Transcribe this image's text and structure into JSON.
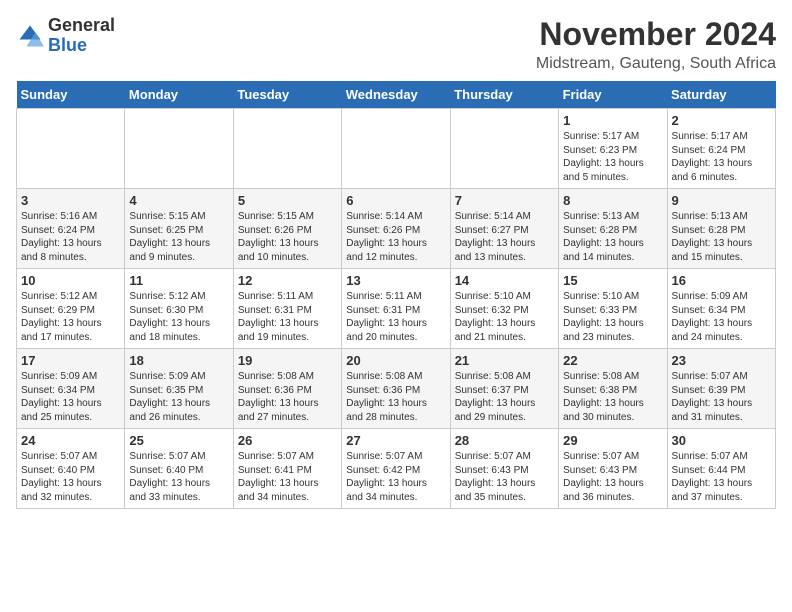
{
  "logo": {
    "general": "General",
    "blue": "Blue"
  },
  "title": "November 2024",
  "location": "Midstream, Gauteng, South Africa",
  "weekdays": [
    "Sunday",
    "Monday",
    "Tuesday",
    "Wednesday",
    "Thursday",
    "Friday",
    "Saturday"
  ],
  "weeks": [
    [
      {
        "day": "",
        "info": ""
      },
      {
        "day": "",
        "info": ""
      },
      {
        "day": "",
        "info": ""
      },
      {
        "day": "",
        "info": ""
      },
      {
        "day": "",
        "info": ""
      },
      {
        "day": "1",
        "info": "Sunrise: 5:17 AM\nSunset: 6:23 PM\nDaylight: 13 hours\nand 5 minutes."
      },
      {
        "day": "2",
        "info": "Sunrise: 5:17 AM\nSunset: 6:24 PM\nDaylight: 13 hours\nand 6 minutes."
      }
    ],
    [
      {
        "day": "3",
        "info": "Sunrise: 5:16 AM\nSunset: 6:24 PM\nDaylight: 13 hours\nand 8 minutes."
      },
      {
        "day": "4",
        "info": "Sunrise: 5:15 AM\nSunset: 6:25 PM\nDaylight: 13 hours\nand 9 minutes."
      },
      {
        "day": "5",
        "info": "Sunrise: 5:15 AM\nSunset: 6:26 PM\nDaylight: 13 hours\nand 10 minutes."
      },
      {
        "day": "6",
        "info": "Sunrise: 5:14 AM\nSunset: 6:26 PM\nDaylight: 13 hours\nand 12 minutes."
      },
      {
        "day": "7",
        "info": "Sunrise: 5:14 AM\nSunset: 6:27 PM\nDaylight: 13 hours\nand 13 minutes."
      },
      {
        "day": "8",
        "info": "Sunrise: 5:13 AM\nSunset: 6:28 PM\nDaylight: 13 hours\nand 14 minutes."
      },
      {
        "day": "9",
        "info": "Sunrise: 5:13 AM\nSunset: 6:28 PM\nDaylight: 13 hours\nand 15 minutes."
      }
    ],
    [
      {
        "day": "10",
        "info": "Sunrise: 5:12 AM\nSunset: 6:29 PM\nDaylight: 13 hours\nand 17 minutes."
      },
      {
        "day": "11",
        "info": "Sunrise: 5:12 AM\nSunset: 6:30 PM\nDaylight: 13 hours\nand 18 minutes."
      },
      {
        "day": "12",
        "info": "Sunrise: 5:11 AM\nSunset: 6:31 PM\nDaylight: 13 hours\nand 19 minutes."
      },
      {
        "day": "13",
        "info": "Sunrise: 5:11 AM\nSunset: 6:31 PM\nDaylight: 13 hours\nand 20 minutes."
      },
      {
        "day": "14",
        "info": "Sunrise: 5:10 AM\nSunset: 6:32 PM\nDaylight: 13 hours\nand 21 minutes."
      },
      {
        "day": "15",
        "info": "Sunrise: 5:10 AM\nSunset: 6:33 PM\nDaylight: 13 hours\nand 23 minutes."
      },
      {
        "day": "16",
        "info": "Sunrise: 5:09 AM\nSunset: 6:34 PM\nDaylight: 13 hours\nand 24 minutes."
      }
    ],
    [
      {
        "day": "17",
        "info": "Sunrise: 5:09 AM\nSunset: 6:34 PM\nDaylight: 13 hours\nand 25 minutes."
      },
      {
        "day": "18",
        "info": "Sunrise: 5:09 AM\nSunset: 6:35 PM\nDaylight: 13 hours\nand 26 minutes."
      },
      {
        "day": "19",
        "info": "Sunrise: 5:08 AM\nSunset: 6:36 PM\nDaylight: 13 hours\nand 27 minutes."
      },
      {
        "day": "20",
        "info": "Sunrise: 5:08 AM\nSunset: 6:36 PM\nDaylight: 13 hours\nand 28 minutes."
      },
      {
        "day": "21",
        "info": "Sunrise: 5:08 AM\nSunset: 6:37 PM\nDaylight: 13 hours\nand 29 minutes."
      },
      {
        "day": "22",
        "info": "Sunrise: 5:08 AM\nSunset: 6:38 PM\nDaylight: 13 hours\nand 30 minutes."
      },
      {
        "day": "23",
        "info": "Sunrise: 5:07 AM\nSunset: 6:39 PM\nDaylight: 13 hours\nand 31 minutes."
      }
    ],
    [
      {
        "day": "24",
        "info": "Sunrise: 5:07 AM\nSunset: 6:40 PM\nDaylight: 13 hours\nand 32 minutes."
      },
      {
        "day": "25",
        "info": "Sunrise: 5:07 AM\nSunset: 6:40 PM\nDaylight: 13 hours\nand 33 minutes."
      },
      {
        "day": "26",
        "info": "Sunrise: 5:07 AM\nSunset: 6:41 PM\nDaylight: 13 hours\nand 34 minutes."
      },
      {
        "day": "27",
        "info": "Sunrise: 5:07 AM\nSunset: 6:42 PM\nDaylight: 13 hours\nand 34 minutes."
      },
      {
        "day": "28",
        "info": "Sunrise: 5:07 AM\nSunset: 6:43 PM\nDaylight: 13 hours\nand 35 minutes."
      },
      {
        "day": "29",
        "info": "Sunrise: 5:07 AM\nSunset: 6:43 PM\nDaylight: 13 hours\nand 36 minutes."
      },
      {
        "day": "30",
        "info": "Sunrise: 5:07 AM\nSunset: 6:44 PM\nDaylight: 13 hours\nand 37 minutes."
      }
    ]
  ]
}
